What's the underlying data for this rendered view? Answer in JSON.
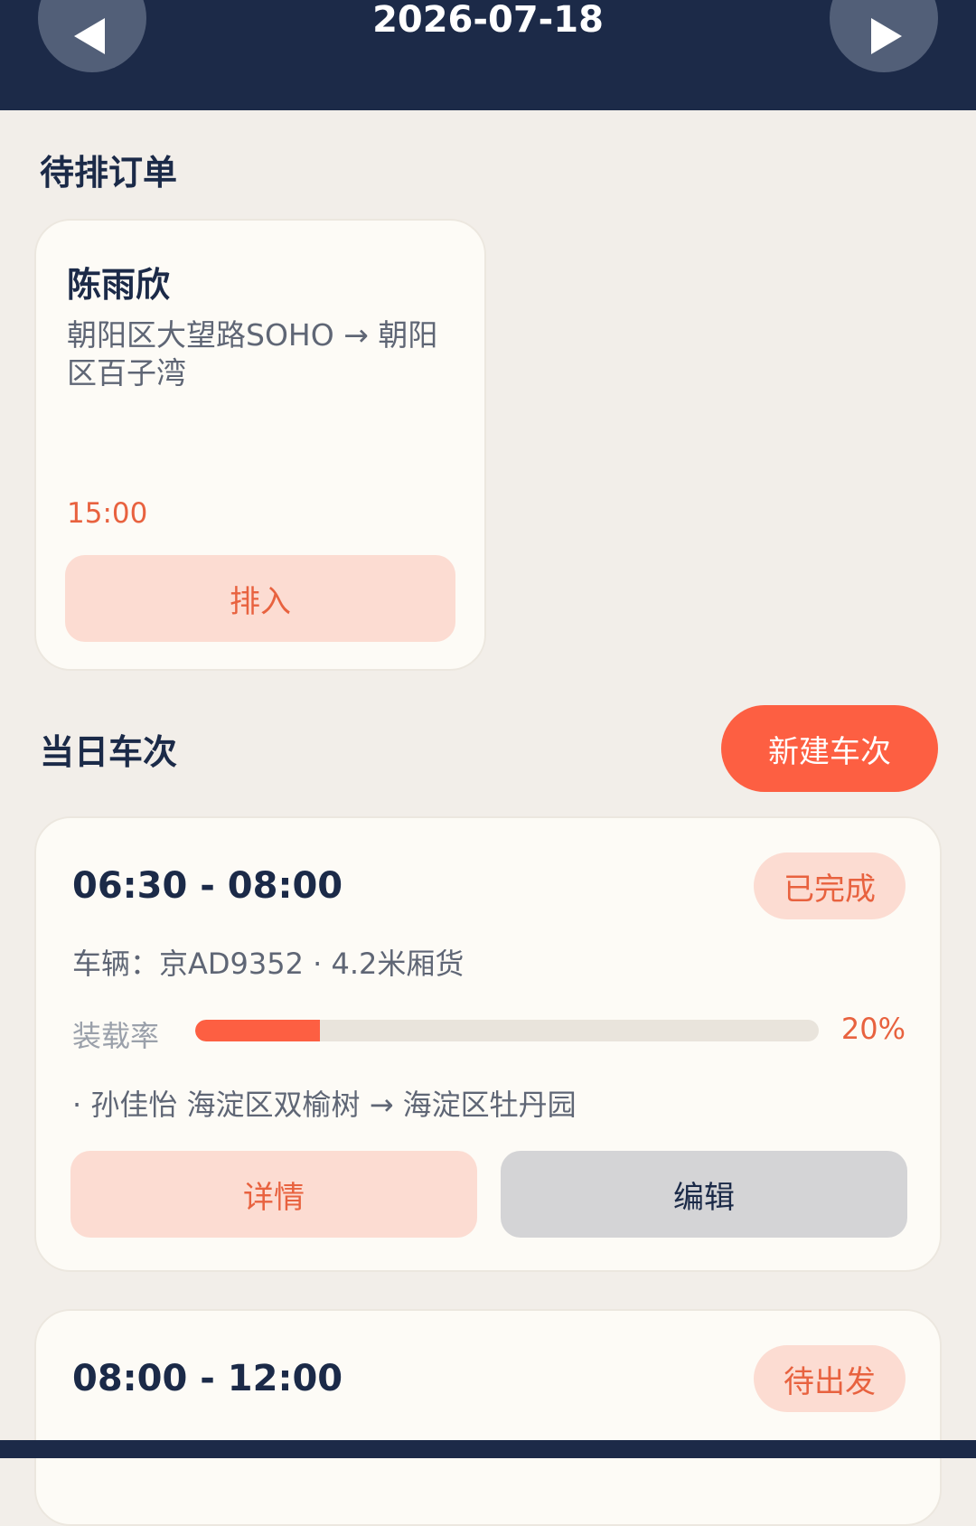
{
  "header": {
    "date": "2026-07-18",
    "prev_icon": "triangle-left-icon",
    "next_icon": "triangle-right-icon"
  },
  "pending": {
    "title": "待排订单",
    "orders": [
      {
        "name": "陈雨欣",
        "route": "朝阳区大望路SOHO → 朝阳区百子湾",
        "time": "15:00",
        "action": "排入"
      }
    ]
  },
  "trips": {
    "title": "当日车次",
    "new_button": "新建车次",
    "items": [
      {
        "time_range": "06:30 - 08:00",
        "status": "已完成",
        "vehicle": "车辆：京AD9352 · 4.2米厢货",
        "load_label": "装载率",
        "load_value": 0.2,
        "load_pct": "20%",
        "stops": [
          "· 孙佳怡 海淀区双榆树 → 海淀区牡丹园"
        ],
        "detail_label": "详情",
        "edit_label": "编辑"
      },
      {
        "time_range": "08:00 - 12:00",
        "status": "待出发"
      }
    ]
  },
  "colors": {
    "header_bg": "#1c2a48",
    "accent": "#fd5f42",
    "accent_soft": "#fcdcd2",
    "page_bg": "#f2eee9"
  }
}
